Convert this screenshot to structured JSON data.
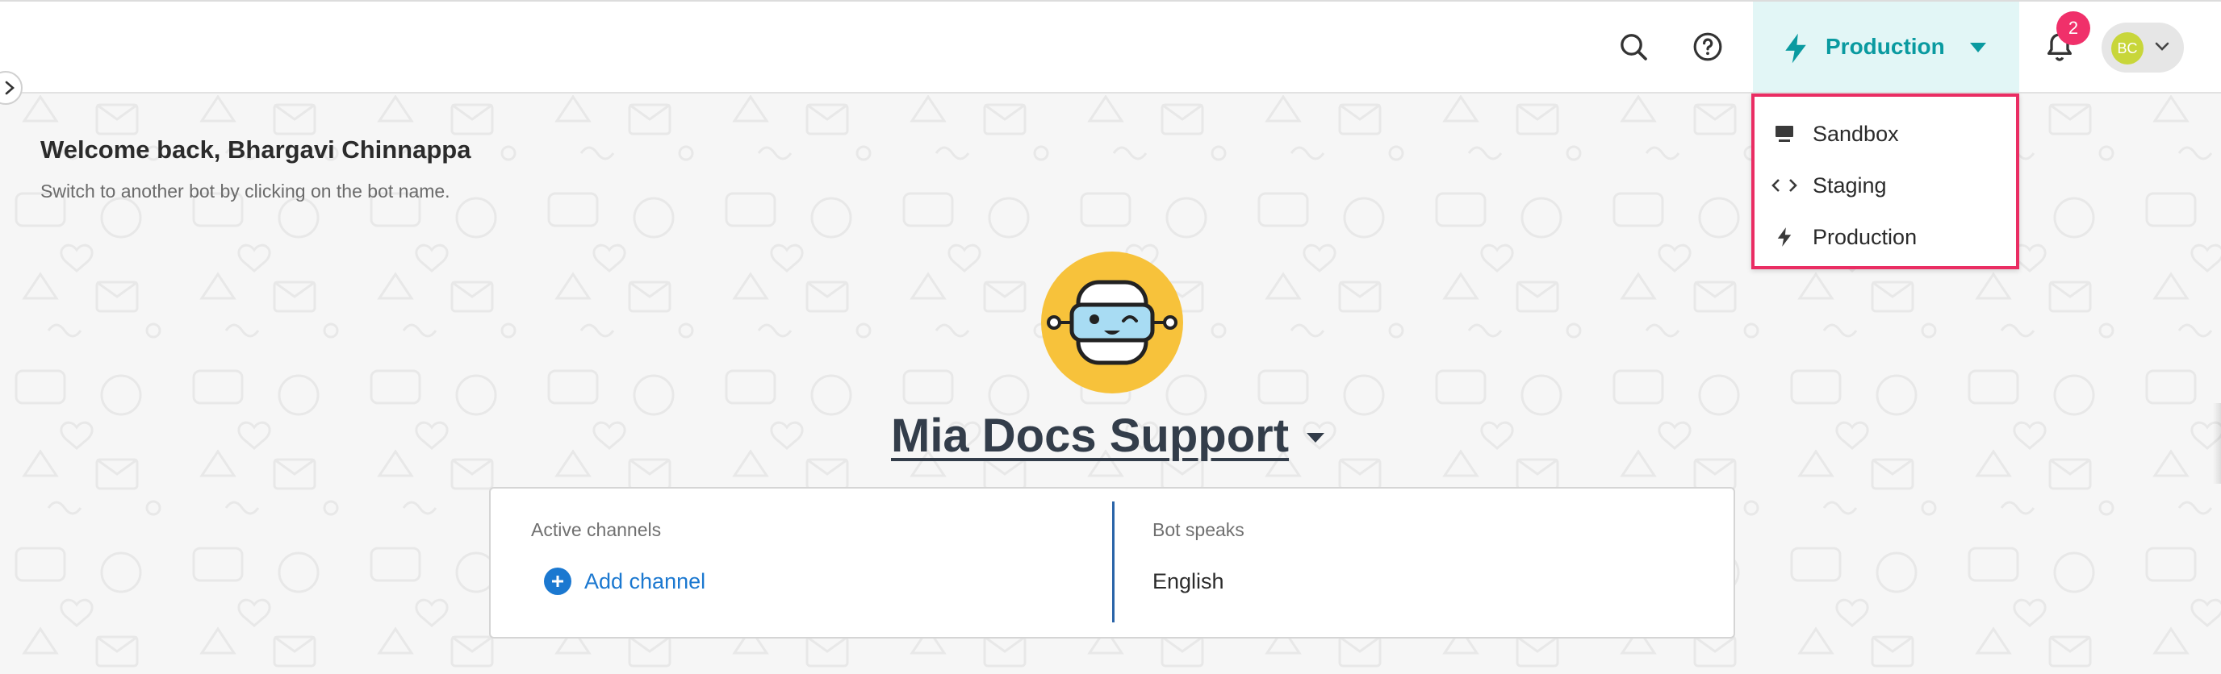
{
  "header": {
    "environment_label": "Production",
    "notification_count": "2",
    "user_initials": "BC"
  },
  "welcome": {
    "title": "Welcome back, Bhargavi Chinnappa",
    "subtitle": "Switch to another bot by clicking on the bot name."
  },
  "bot": {
    "name": "Mia Docs Support"
  },
  "info_card": {
    "channels_label": "Active channels",
    "add_channel_label": "Add channel",
    "speaks_label": "Bot speaks",
    "language": "English"
  },
  "env_menu": {
    "items": [
      {
        "label": "Sandbox",
        "icon": "desktop-icon"
      },
      {
        "label": "Staging",
        "icon": "code-icon"
      },
      {
        "label": "Production",
        "icon": "bolt-icon"
      }
    ]
  },
  "colors": {
    "accent_teal": "#0a9aa0",
    "env_bg": "#e2f6f6",
    "badge": "#f0306a",
    "link_blue": "#1b78d0",
    "highlight_border": "#ea2d63",
    "bot_avatar_bg": "#f7c23b",
    "user_avatar_bg": "#c8d63a"
  }
}
